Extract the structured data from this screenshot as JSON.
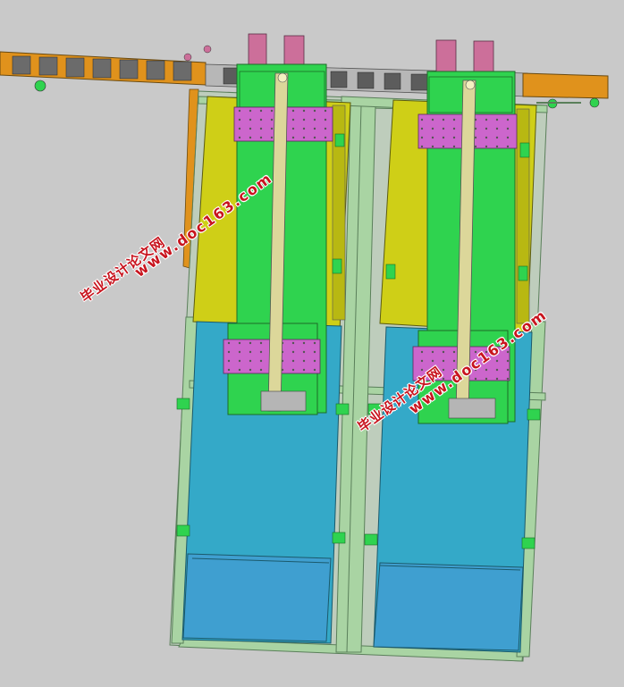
{
  "colors": {
    "background": "#c9c9c9",
    "frame": "#a9d4a3",
    "frame_dark": "#5a7f5a",
    "green": "#2fd34f",
    "yellow": "#cfcf17",
    "magenta": "#cc66cc",
    "cyan": "#34a9c8",
    "blue": "#3f9fd0",
    "orange": "#e0921c",
    "pink": "#cc6f9a",
    "rod": "#dcd79a",
    "watermark": "#c8141e"
  },
  "watermarks": [
    {
      "line1": "毕业设计论文网",
      "line2": "www.doc163.com"
    },
    {
      "line1": "毕业设计论文网",
      "line2": "www.doc163.com"
    }
  ]
}
